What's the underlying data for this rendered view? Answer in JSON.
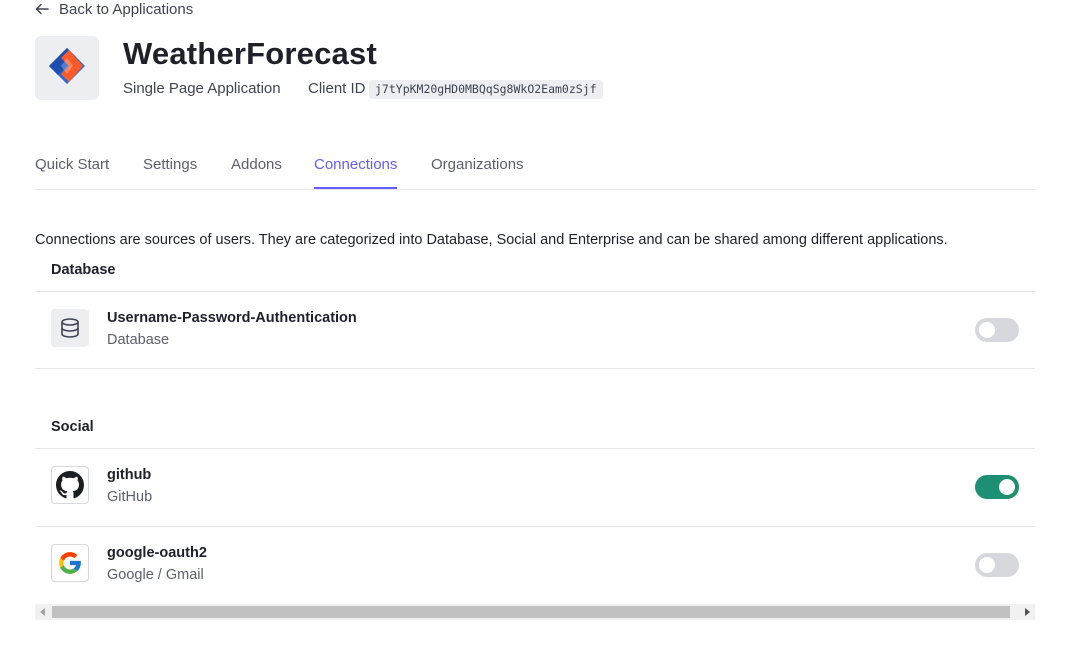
{
  "back_link": {
    "label": "Back to Applications",
    "icon": "arrow-left-icon"
  },
  "app": {
    "name": "WeatherForecast",
    "type": "Single Page Application",
    "client_id_label": "Client ID",
    "client_id": "j7tYpKM20gHD0MBQqSg8WkO2Eam0zSjf",
    "logo_icon": "app-diamond-logo-icon",
    "logo_colors": [
      "#2b6bd4",
      "#ff5a28"
    ]
  },
  "tabs": [
    {
      "label": "Quick Start",
      "active": false
    },
    {
      "label": "Settings",
      "active": false
    },
    {
      "label": "Addons",
      "active": false
    },
    {
      "label": "Connections",
      "active": true
    },
    {
      "label": "Organizations",
      "active": false
    }
  ],
  "description": "Connections are sources of users. They are categorized into Database, Social and Enterprise and can be shared among different applications.",
  "sections": {
    "database": {
      "title": "Database",
      "items": [
        {
          "name": "Username-Password-Authentication",
          "subtitle": "Database",
          "icon": "database-icon",
          "enabled": false
        }
      ]
    },
    "social": {
      "title": "Social",
      "items": [
        {
          "name": "github",
          "subtitle": "GitHub",
          "icon": "github-icon",
          "enabled": true
        },
        {
          "name": "google-oauth2",
          "subtitle": "Google / Gmail",
          "icon": "google-icon",
          "enabled": false
        }
      ]
    }
  },
  "colors": {
    "accent": "#635dff",
    "toggle_on": "#1d8f72",
    "toggle_off": "#d6d8dd"
  }
}
